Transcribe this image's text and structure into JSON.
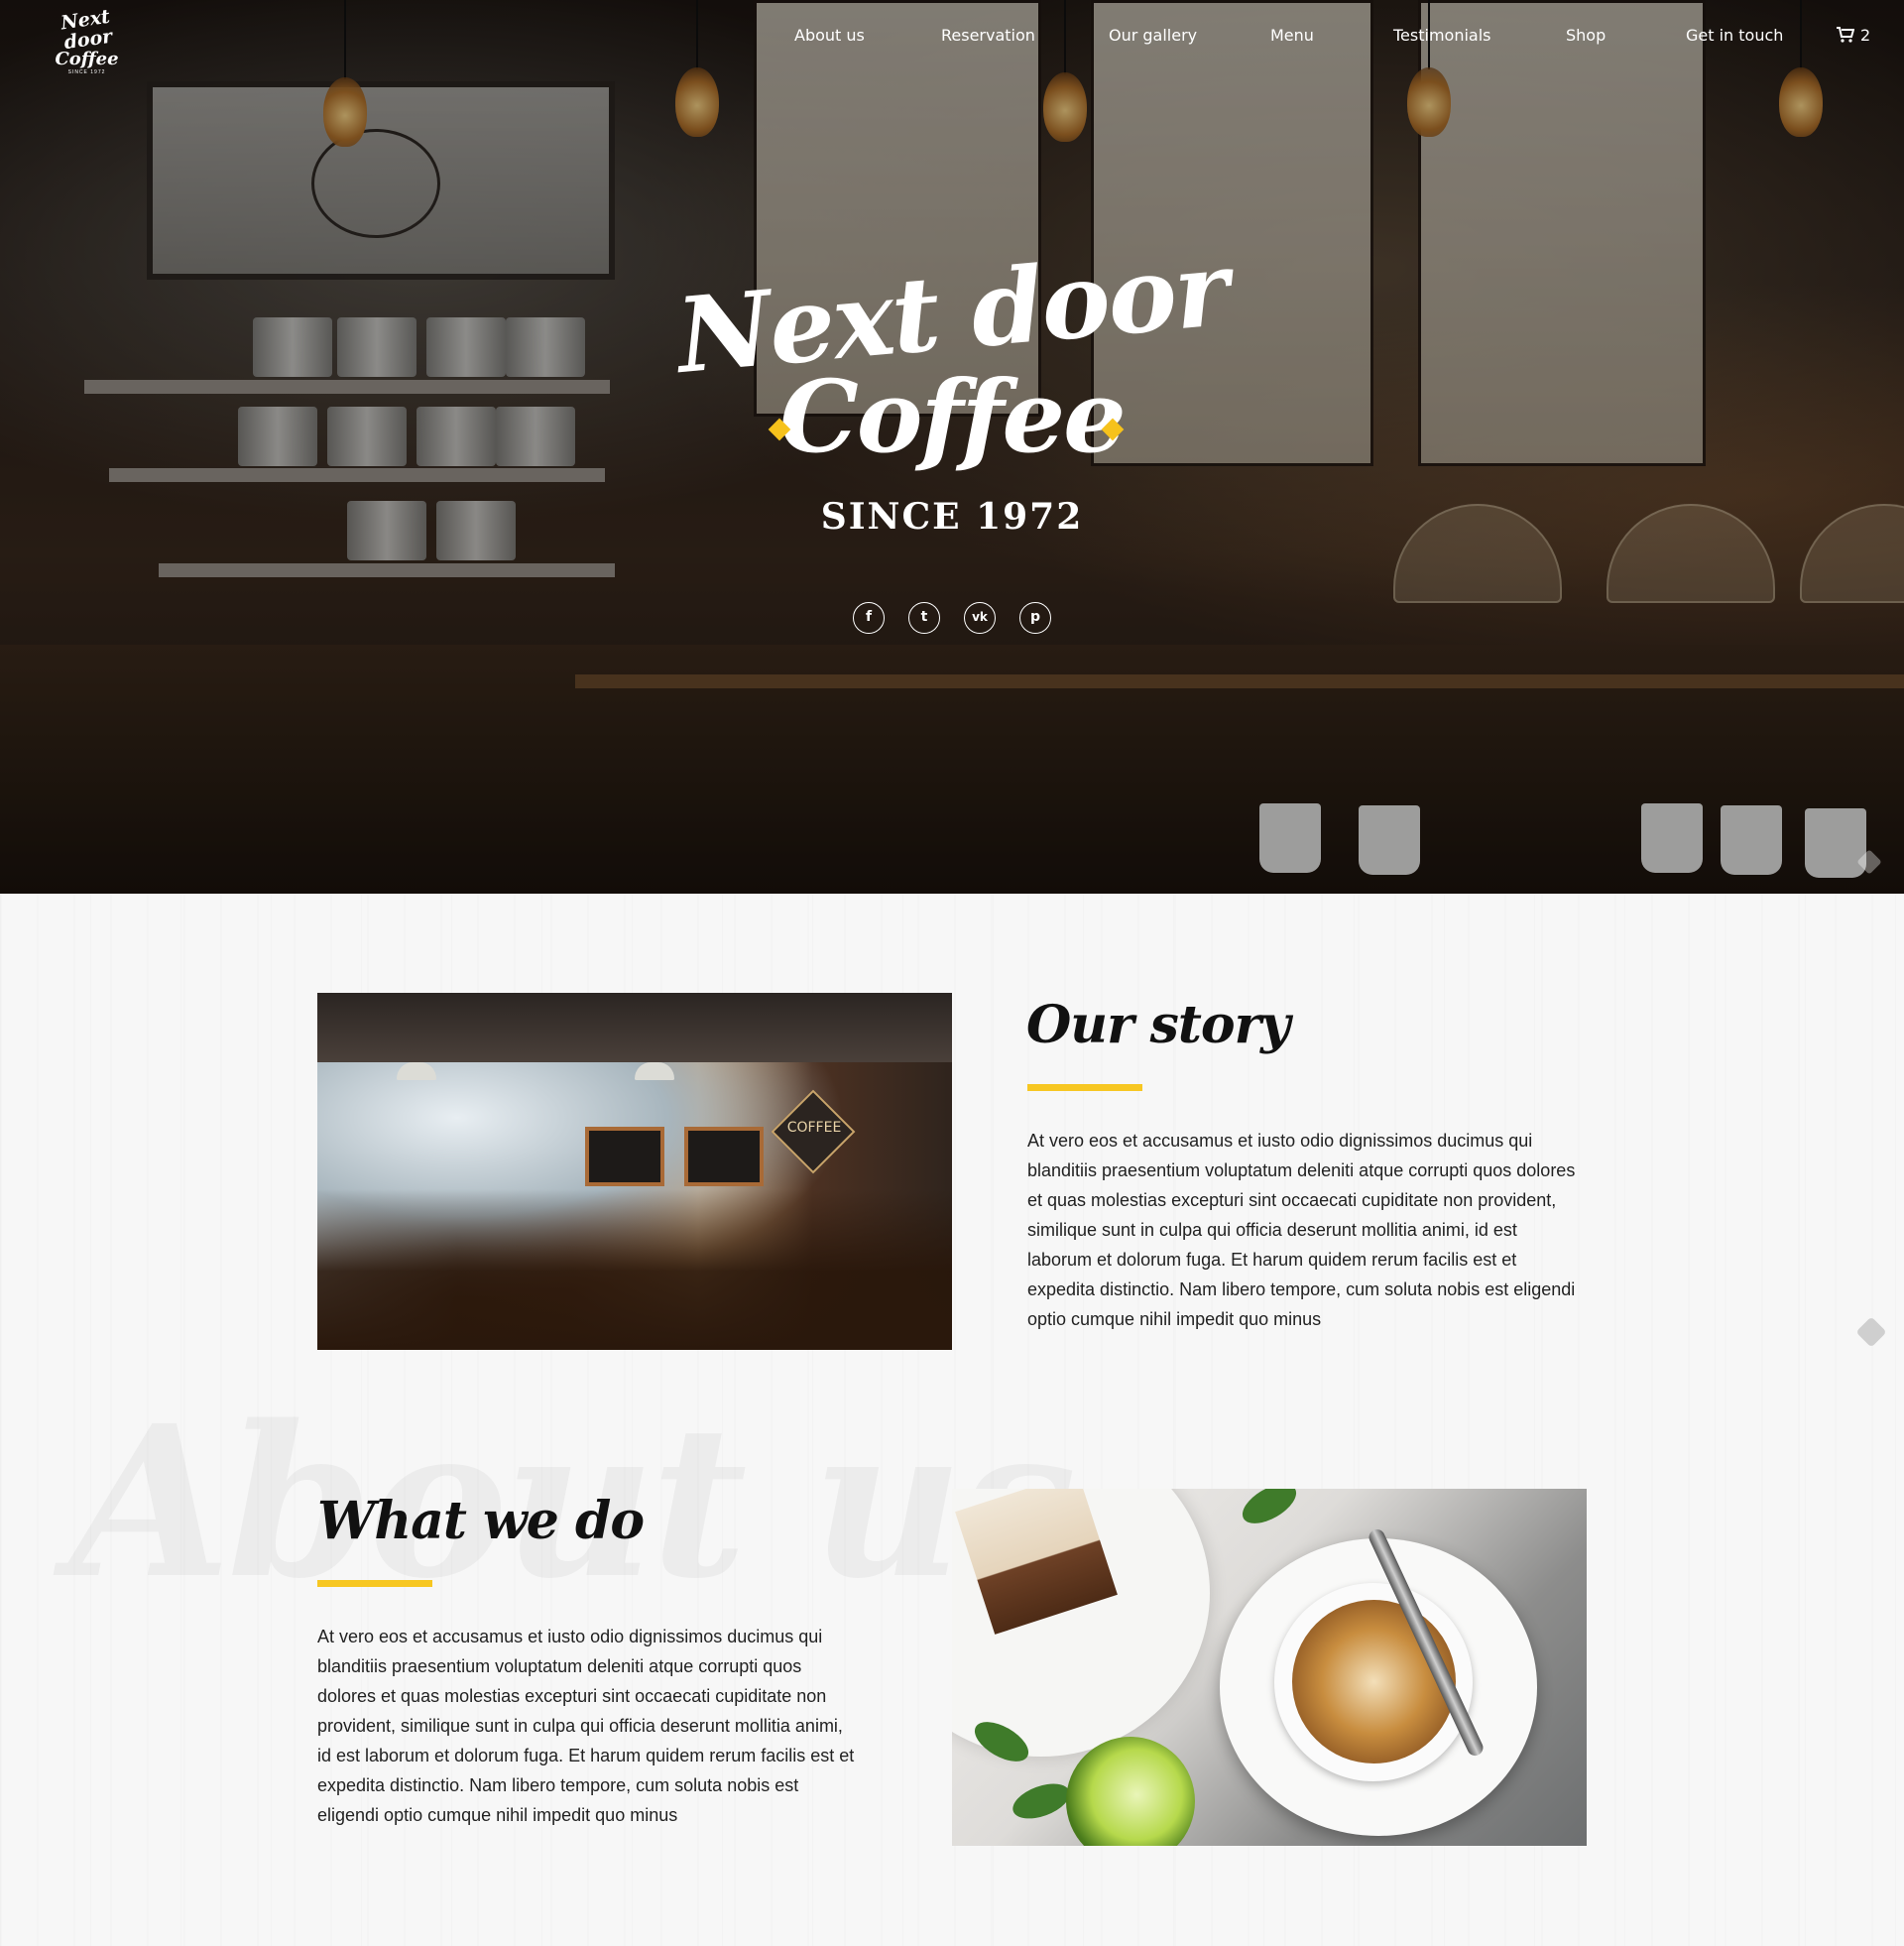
{
  "brand": {
    "logo_line1": "Next door",
    "logo_line2": "Coffee",
    "logo_since": "SINCE 1972"
  },
  "nav": {
    "items": [
      {
        "label": "About us"
      },
      {
        "label": "Reservation"
      },
      {
        "label": "Our gallery"
      },
      {
        "label": "Menu"
      },
      {
        "label": "Testimonials"
      },
      {
        "label": "Shop"
      },
      {
        "label": "Get in touch"
      }
    ],
    "cart_count": "2"
  },
  "hero": {
    "title_line1": "Next door",
    "title_line2": "Coffee",
    "since": "SINCE 1972",
    "socials": [
      {
        "icon": "facebook-icon",
        "glyph": "f"
      },
      {
        "icon": "twitter-icon",
        "glyph": "t"
      },
      {
        "icon": "vk-icon",
        "glyph": "vk"
      },
      {
        "icon": "pinterest-icon",
        "glyph": "p"
      }
    ]
  },
  "about": {
    "watermark": "About us",
    "story": {
      "title": "Our story",
      "text": "At vero eos et accusamus et iusto odio dignissimos ducimus qui blanditiis praesentium voluptatum deleniti atque corrupti quos dolores et quas molestias excepturi sint occaecati cupiditate non provident, similique sunt in culpa qui officia deserunt mollitia animi, id est laborum et dolorum fuga. Et harum quidem rerum facilis est et expedita distinctio. Nam libero tempore, cum soluta nobis est eligendi optio cumque nihil impedit quo minus"
    },
    "what_we_do": {
      "title": "What we do",
      "text": "At vero eos et accusamus et iusto odio dignissimos ducimus qui blanditiis praesentium voluptatum deleniti atque corrupti quos dolores et quas molestias excepturi sint occaecati cupiditate non provident, similique sunt in culpa qui officia deserunt mollitia animi, id est laborum et dolorum fuga. Et harum quidem rerum facilis est et expedita distinctio. Nam libero tempore, cum soluta nobis est eligendi optio cumque nihil impedit quo minus"
    },
    "photo_sign_text": "COFFEE"
  },
  "colors": {
    "accent": "#f7c722",
    "text": "#222222",
    "hero_text": "#ffffff"
  }
}
